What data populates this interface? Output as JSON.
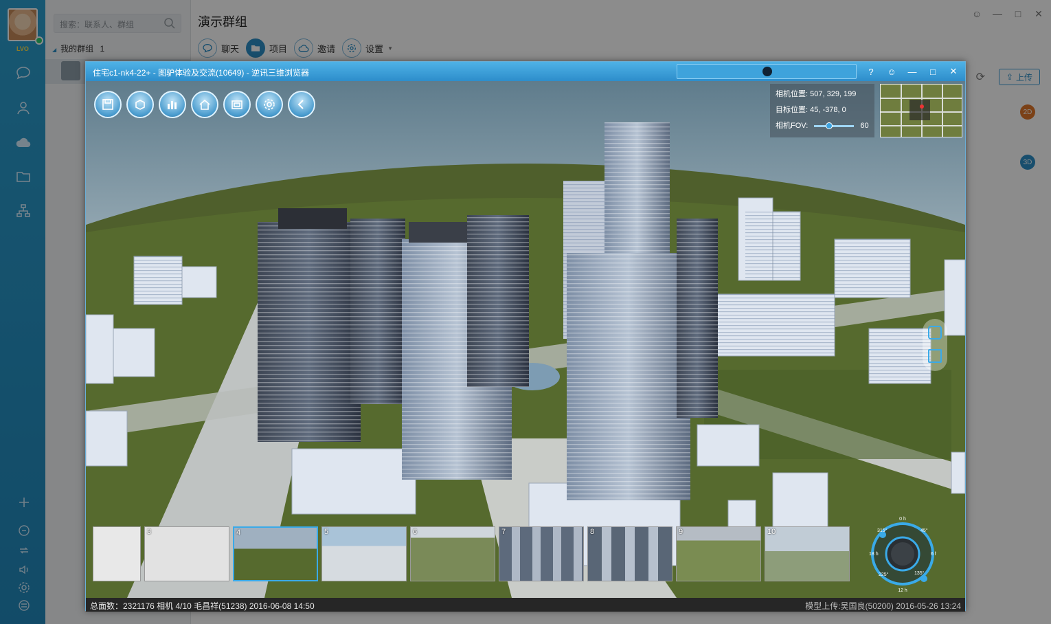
{
  "app": {
    "avatar_tag": "LVO",
    "search_placeholder": "搜索：联系人、群组",
    "group_section": "我的群组",
    "group_count": "1"
  },
  "main": {
    "title": "演示群组",
    "tabs": [
      {
        "label": "聊天",
        "icon": "chat-icon"
      },
      {
        "label": "项目",
        "icon": "folder-icon"
      },
      {
        "label": "邀请",
        "icon": "invite-cloud-icon"
      },
      {
        "label": "设置",
        "icon": "gear-icon"
      }
    ],
    "upload_label": "上传",
    "badges": [
      "2D",
      "3D"
    ]
  },
  "viewer": {
    "title": "住宅c1-nk4-22+ - 图驴体验及交流(10649) - 逆讯三维浏览器",
    "info": {
      "camera_pos_label": "相机位置:",
      "camera_pos_value": "507, 329, 199",
      "target_pos_label": "目标位置:",
      "target_pos_value": "45, -378, 0",
      "fov_label": "相机FOV:",
      "fov_value": "60"
    },
    "thumbnails": [
      {
        "num": ""
      },
      {
        "num": "3"
      },
      {
        "num": "4"
      },
      {
        "num": "5"
      },
      {
        "num": "6"
      },
      {
        "num": "7"
      },
      {
        "num": "8"
      },
      {
        "num": "9"
      },
      {
        "num": "10"
      }
    ],
    "compass_labels": {
      "n": "0 h",
      "ne": "45°",
      "e": "6 h",
      "se": "135°",
      "s": "12 h",
      "sw": "225°",
      "w": "18 h",
      "nw": "315°"
    },
    "status_left": "总面数：2321176  相机  4/10  毛昌祥(51238)  2016-06-08 14:50",
    "status_right": "模型上传:吴国良(50200)        2016-05-26 13:24"
  },
  "colors": {
    "rail": "#2289bd",
    "accent": "#2c8fc7",
    "title_bar": "#3a9fd9",
    "badge_2d": "#e0772b",
    "badge_3d": "#2c8fc7"
  }
}
